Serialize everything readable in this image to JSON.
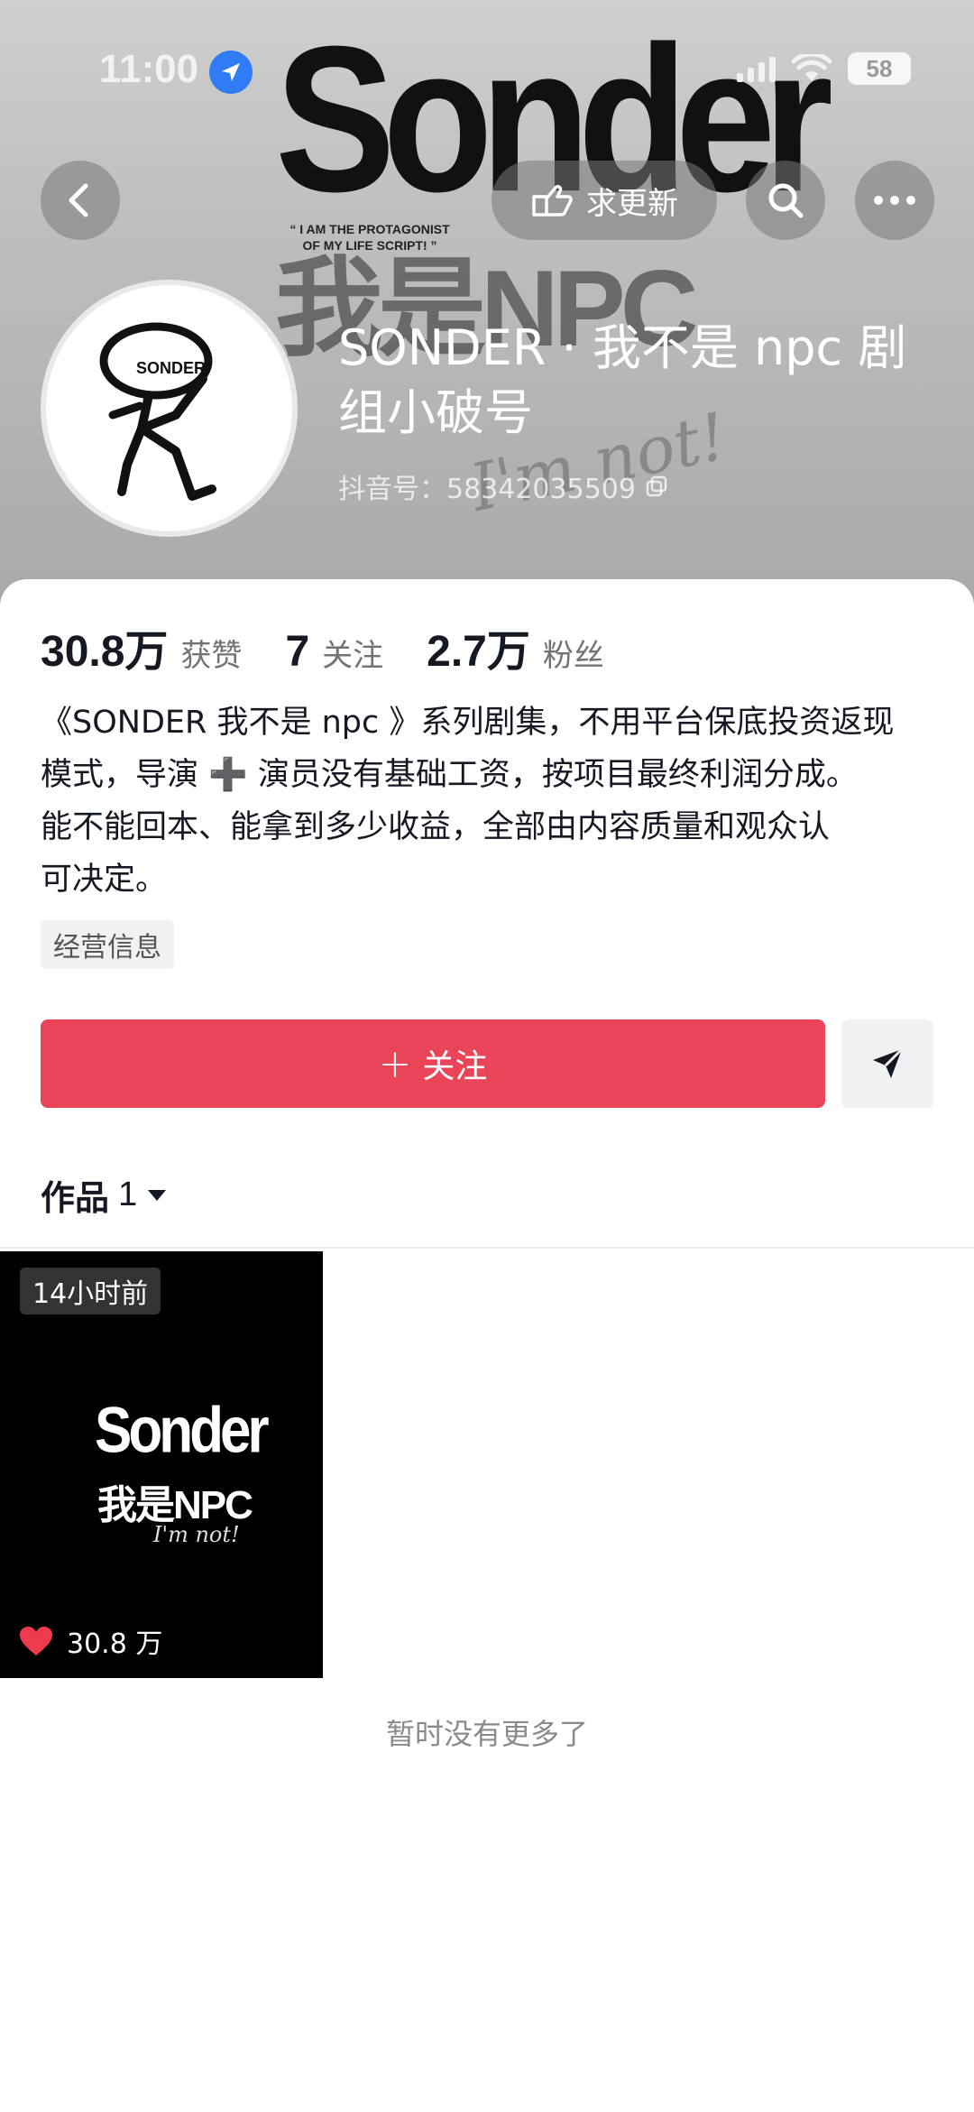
{
  "status_bar": {
    "time": "11:00",
    "battery": "58"
  },
  "banner": {
    "art_title": "Sonder",
    "art_quote": "“ I AM THE PROTAGONIST OF MY LIFE SCRIPT! ”",
    "art_subtitle": "我是NPC",
    "art_scrawl": "I'm not!"
  },
  "nav": {
    "request_update_label": "求更新"
  },
  "profile": {
    "avatar_tag": "SONDER",
    "nickname": "SONDER · 我不是 npc 剧组小破号",
    "douyin_id": "抖音号：58342035509"
  },
  "stats": [
    {
      "value": "30.8万",
      "label": "获赞"
    },
    {
      "value": "7",
      "label": "关注"
    },
    {
      "value": "2.7万",
      "label": "粉丝"
    }
  ],
  "bio": [
    "《SONDER 我不是 npc 》系列剧集，不用平台保底投资返现",
    "模式，导演 ➕ 演员没有基础工资，按项目最终利润分成。",
    "能不能回本、能拿到多少收益，全部由内容质量和观众认",
    "可决定。"
  ],
  "business_tag": "经营信息",
  "actions": {
    "follow_plus": "+",
    "follow_label": "关注"
  },
  "works_tab": {
    "label": "作品",
    "count": "1"
  },
  "video": {
    "time_ago": "14小时前",
    "thumb_title": "Sonder",
    "thumb_subtitle": "我是NPC",
    "thumb_scrawl": "I'm not!",
    "likes": "30.8 万"
  },
  "footer_text": "暂时没有更多了",
  "colors": {
    "follow_button": "#ea4458",
    "location_icon": "#2f7cf6",
    "like_heart": "#ee3a4f"
  }
}
